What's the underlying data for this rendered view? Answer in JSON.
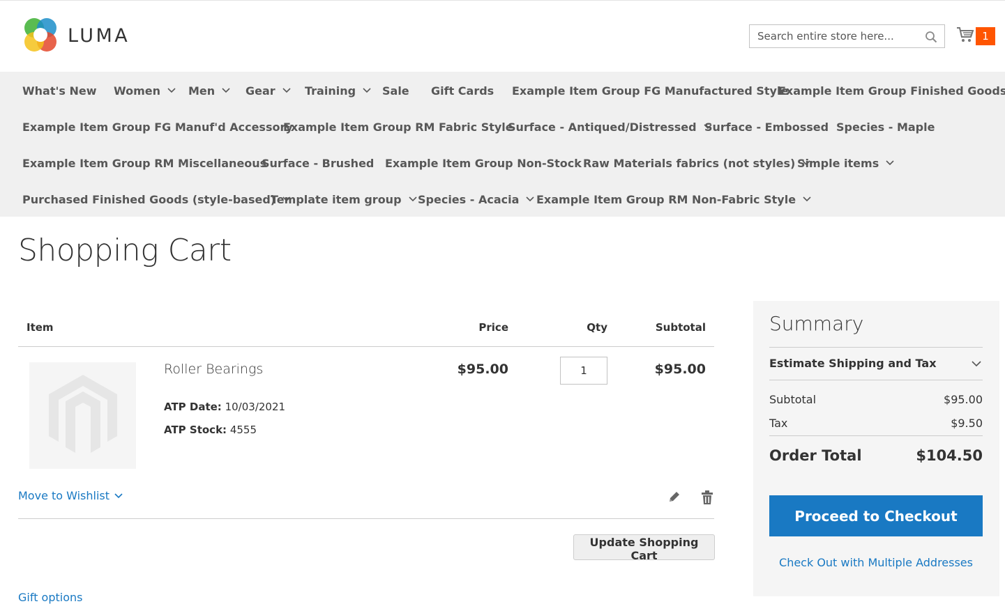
{
  "header": {
    "logo_text": "LUMA",
    "search": {
      "placeholder": "Search entire store here..."
    },
    "cart_count": "1"
  },
  "nav": {
    "items": [
      {
        "label": "What's New",
        "has_submenu": false
      },
      {
        "label": "Women",
        "has_submenu": true
      },
      {
        "label": "Men",
        "has_submenu": true
      },
      {
        "label": "Gear",
        "has_submenu": true
      },
      {
        "label": "Training",
        "has_submenu": true
      },
      {
        "label": "Sale",
        "has_submenu": false
      },
      {
        "label": "Gift Cards",
        "has_submenu": false
      },
      {
        "label": "Example Item Group FG Manufactured Style",
        "has_submenu": false
      },
      {
        "label": "Example Item Group Finished Goods",
        "has_submenu": false
      },
      {
        "label": "Example Item Group FG Manuf'd Accessory",
        "has_submenu": false
      },
      {
        "label": "Example Item Group RM Fabric Style",
        "has_submenu": false
      },
      {
        "label": "Surface - Antiqued/Distressed",
        "has_submenu": true
      },
      {
        "label": "Surface - Embossed",
        "has_submenu": false
      },
      {
        "label": "Species - Maple",
        "has_submenu": false
      },
      {
        "label": "Example Item Group RM Miscellaneous",
        "has_submenu": false
      },
      {
        "label": "Surface - Brushed",
        "has_submenu": false
      },
      {
        "label": "Example Item Group Non-Stock",
        "has_submenu": false
      },
      {
        "label": "Raw Materials fabrics (not styles)",
        "has_submenu": true
      },
      {
        "label": "Simple items",
        "has_submenu": true
      },
      {
        "label": "Purchased Finished Goods (style-based)",
        "has_submenu": true
      },
      {
        "label": "Template item group",
        "has_submenu": true
      },
      {
        "label": "Species - Acacia",
        "has_submenu": true
      },
      {
        "label": "Example Item Group RM Non-Fabric Style",
        "has_submenu": true
      }
    ]
  },
  "page_title": "Shopping Cart",
  "cart": {
    "headers": {
      "item": "Item",
      "price": "Price",
      "qty": "Qty",
      "subtotal": "Subtotal"
    },
    "items": [
      {
        "name": "Roller Bearings",
        "options": [
          {
            "label": "ATP Date:",
            "value": "10/03/2021"
          },
          {
            "label": "ATP Stock:",
            "value": "4555"
          }
        ],
        "price": "$95.00",
        "qty": "1",
        "subtotal": "$95.00"
      }
    ],
    "move_to_wishlist": "Move to Wishlist",
    "update_button": "Update Shopping Cart",
    "gift_options_peek": "Gift options"
  },
  "summary": {
    "title": "Summary",
    "estimate_label": "Estimate Shipping and Tax",
    "subtotal_label": "Subtotal",
    "subtotal_value": "$95.00",
    "tax_label": "Tax",
    "tax_value": "$9.50",
    "order_total_label": "Order Total",
    "order_total_value": "$104.50",
    "checkout_button": "Proceed to Checkout",
    "multi_address_link": "Check Out with Multiple Addresses"
  },
  "colors": {
    "accent_blue": "#1979c3",
    "cart_badge": "#ff5501",
    "nav_bg": "#f0f0f0",
    "summary_bg": "#f5f5f5"
  }
}
